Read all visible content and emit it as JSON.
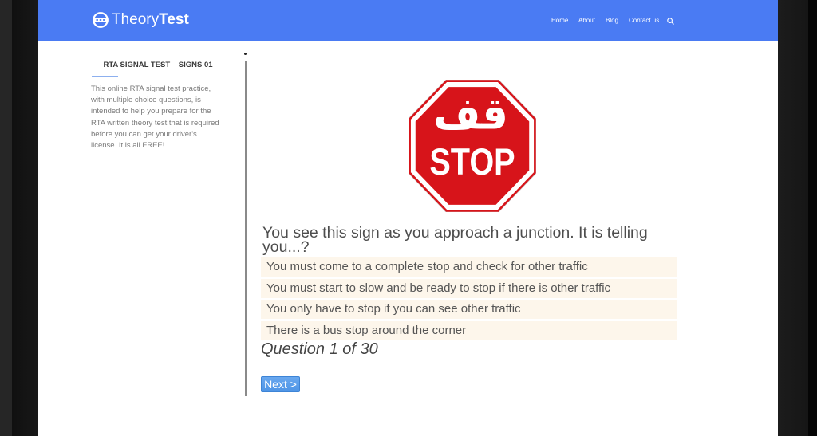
{
  "header": {
    "logo": {
      "text_regular": "Theory",
      "text_bold": "Test",
      "icon": "steering-wheel-icon"
    },
    "nav": [
      "Home",
      "About",
      "Blog",
      "Contact us"
    ],
    "search_icon": "search-icon"
  },
  "sidebar": {
    "title": "RTA SIGNAL TEST – SIGNS 01",
    "description": "This online RTA signal test practice, with multiple choice questions, is intended to help you prepare for the RTA written theory test that is required before you can get your driver's license. It is all FREE!"
  },
  "quiz": {
    "sign": {
      "arabic_text": "قف",
      "english_text": "STOP"
    },
    "question": "You see this sign as you approach a junction. It is telling you...?",
    "options": [
      "You must come to a complete stop and check for other traffic",
      "You must start to slow and be ready to stop if there is other traffic",
      "You only have to stop if you can see other traffic",
      "There is a bus stop around the corner"
    ],
    "counter": "Question 1 of 30",
    "next_button": "Next >"
  },
  "colors": {
    "header_bg": "#4a7bf3",
    "accent_line": "#8db0ef",
    "option_bg": "#fdf6eb",
    "button_bg": "#4f95e6",
    "stop_red": "#d7141a",
    "text_dark": "#4d4d4d"
  }
}
